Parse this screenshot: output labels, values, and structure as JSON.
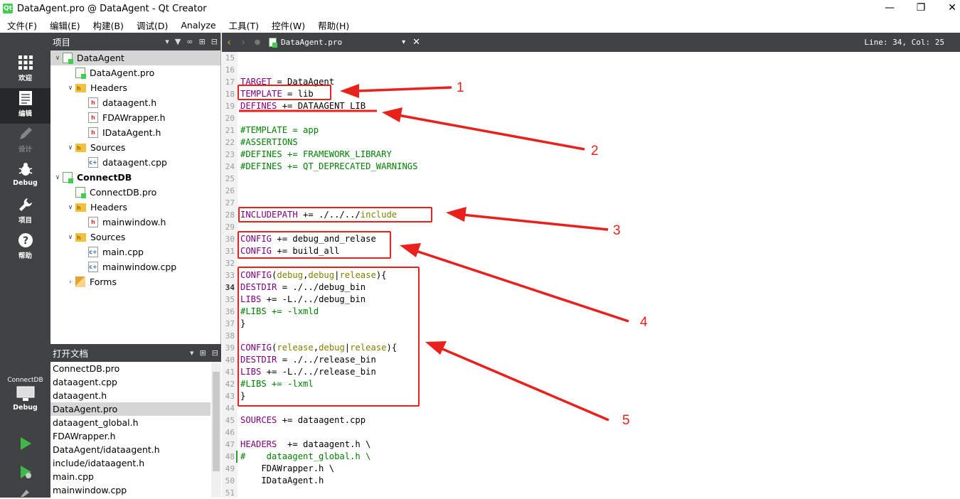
{
  "window": {
    "title": "DataAgent.pro @ DataAgent - Qt Creator",
    "app_icon": "qt-icon",
    "controls": [
      "minimize-icon",
      "restore-icon",
      "close-icon"
    ]
  },
  "menu": [
    "文件(F)",
    "编辑(E)",
    "构建(B)",
    "调试(D)",
    "Analyze",
    "工具(T)",
    "控件(W)",
    "帮助(H)"
  ],
  "modes": [
    {
      "label": "欢迎",
      "icon": "grid-icon"
    },
    {
      "label": "编辑",
      "icon": "document-icon"
    },
    {
      "label": "设计",
      "icon": "pencil-icon"
    },
    {
      "label": "Debug",
      "icon": "bug-icon"
    },
    {
      "label": "项目",
      "icon": "wrench-icon"
    },
    {
      "label": "帮助",
      "icon": "help-icon"
    }
  ],
  "target": {
    "project": "ConnectDB",
    "build": "Debug"
  },
  "projects_panel": {
    "title": "项目",
    "tree": [
      {
        "label": "DataAgent",
        "type": "pro",
        "level": 0,
        "expanded": true,
        "selected": true
      },
      {
        "label": "DataAgent.pro",
        "type": "pro",
        "level": 1
      },
      {
        "label": "Headers",
        "type": "folder",
        "level": 1,
        "expanded": true
      },
      {
        "label": "dataagent.h",
        "type": "h",
        "level": 2
      },
      {
        "label": "FDAWrapper.h",
        "type": "h",
        "level": 2
      },
      {
        "label": "IDataAgent.h",
        "type": "h",
        "level": 2
      },
      {
        "label": "Sources",
        "type": "folder",
        "level": 1,
        "expanded": true
      },
      {
        "label": "dataagent.cpp",
        "type": "cpp",
        "level": 2
      },
      {
        "label": "ConnectDB",
        "type": "pro",
        "level": 0,
        "expanded": true,
        "bold": true
      },
      {
        "label": "ConnectDB.pro",
        "type": "pro",
        "level": 1
      },
      {
        "label": "Headers",
        "type": "folder",
        "level": 1,
        "expanded": true
      },
      {
        "label": "mainwindow.h",
        "type": "h",
        "level": 2
      },
      {
        "label": "Sources",
        "type": "folder",
        "level": 1,
        "expanded": true
      },
      {
        "label": "main.cpp",
        "type": "cpp",
        "level": 2
      },
      {
        "label": "mainwindow.cpp",
        "type": "cpp",
        "level": 2
      },
      {
        "label": "Forms",
        "type": "forms",
        "level": 1,
        "expanded": false
      }
    ]
  },
  "open_docs": {
    "title": "打开文档",
    "items": [
      "ConnectDB.pro",
      "dataagent.cpp",
      "dataagent.h",
      "DataAgent.pro",
      "dataagent_global.h",
      "FDAWrapper.h",
      "DataAgent/idataagent.h",
      "include/idataagent.h",
      "main.cpp",
      "mainwindow.cpp"
    ],
    "selected": "DataAgent.pro"
  },
  "editor": {
    "file": "DataAgent.pro",
    "position": "Line: 34, Col: 25",
    "current_line": "34",
    "lines": [
      {
        "n": "15",
        "t": ""
      },
      {
        "n": "16",
        "t": ""
      },
      {
        "n": "17",
        "t": "TARGET = DataAgent"
      },
      {
        "n": "18",
        "t": "TEMPLATE = lib"
      },
      {
        "n": "19",
        "t": "DEFINES += DATAAGENT_LIB"
      },
      {
        "n": "20",
        "t": ""
      },
      {
        "n": "21",
        "t": "#TEMPLATE = app"
      },
      {
        "n": "22",
        "t": "#ASSERTIONS"
      },
      {
        "n": "23",
        "t": "#DEFINES += FRAMEWORK_LIBRARY"
      },
      {
        "n": "24",
        "t": "#DEFINES += QT_DEPRECATED_WARNINGS"
      },
      {
        "n": "25",
        "t": ""
      },
      {
        "n": "26",
        "t": ""
      },
      {
        "n": "27",
        "t": ""
      },
      {
        "n": "28",
        "t": "INCLUDEPATH += ./../../include"
      },
      {
        "n": "29",
        "t": ""
      },
      {
        "n": "30",
        "t": "CONFIG += debug_and_relase"
      },
      {
        "n": "31",
        "t": "CONFIG += build_all"
      },
      {
        "n": "32",
        "t": ""
      },
      {
        "n": "33",
        "t": "CONFIG(debug,debug|release){"
      },
      {
        "n": "34",
        "t": "DESTDIR = ./../debug_bin"
      },
      {
        "n": "35",
        "t": "LIBS += -L./../debug_bin"
      },
      {
        "n": "36",
        "t": "#LIBS += -lxmld"
      },
      {
        "n": "37",
        "t": "}"
      },
      {
        "n": "38",
        "t": ""
      },
      {
        "n": "39",
        "t": "CONFIG(release,debug|release){"
      },
      {
        "n": "40",
        "t": "DESTDIR = ./../release_bin"
      },
      {
        "n": "41",
        "t": "LIBS += -L./../release_bin"
      },
      {
        "n": "42",
        "t": "#LIBS += -lxml"
      },
      {
        "n": "43",
        "t": "}"
      },
      {
        "n": "44",
        "t": ""
      },
      {
        "n": "45",
        "t": "SOURCES += dataagent.cpp"
      },
      {
        "n": "46",
        "t": ""
      },
      {
        "n": "47",
        "t": "HEADERS  += dataagent.h \\"
      },
      {
        "n": "48",
        "t": "#    dataagent_global.h \\"
      },
      {
        "n": "49",
        "t": "    FDAWrapper.h \\"
      },
      {
        "n": "50",
        "t": "    IDataAgent.h"
      },
      {
        "n": "51",
        "t": ""
      }
    ]
  },
  "annotations": [
    "1",
    "2",
    "3",
    "4",
    "5"
  ],
  "colors": {
    "annotation": "#e8211c",
    "keyword": "#800080",
    "comment": "#008000",
    "condition": "#808000",
    "sidebar": "#404244"
  }
}
